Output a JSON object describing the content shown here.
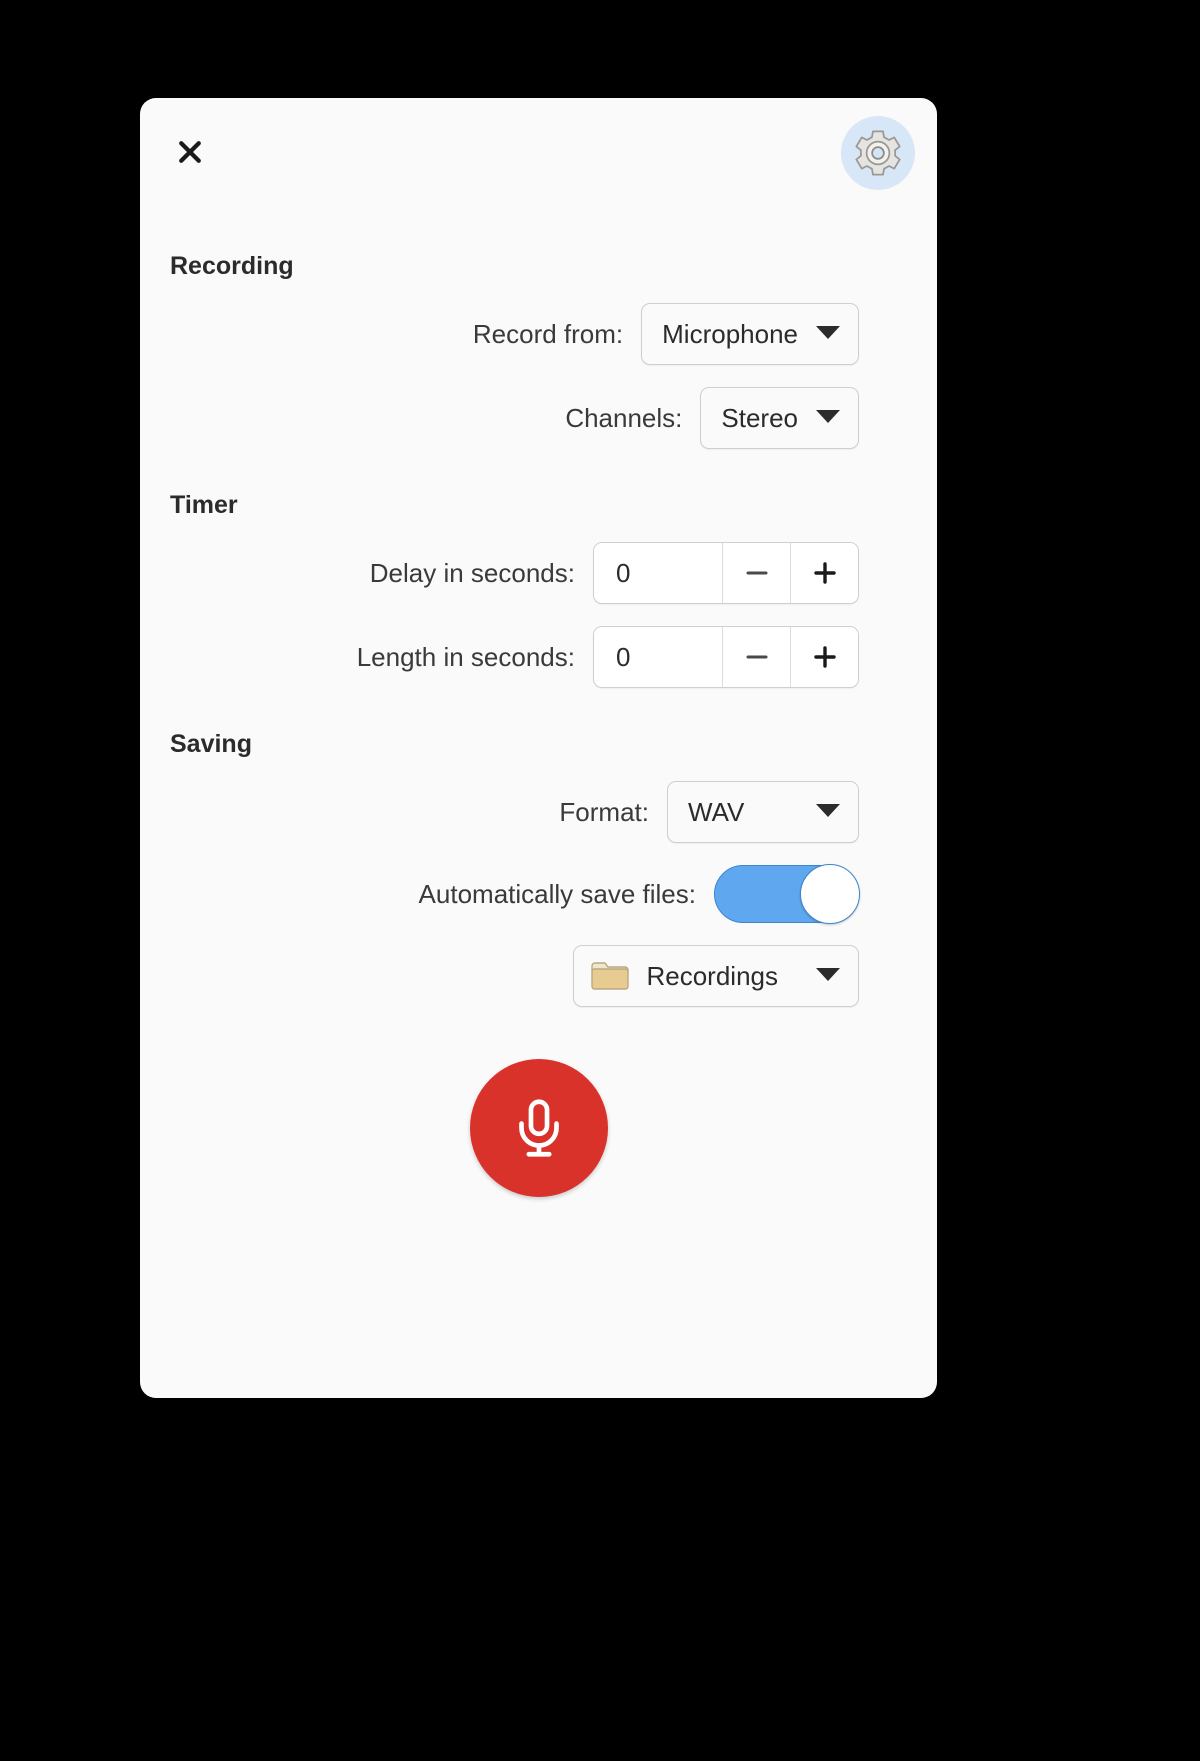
{
  "window": {
    "close_label": "✕",
    "close_icon": "close-icon",
    "settings_icon": "gear-icon"
  },
  "sections": {
    "recording": {
      "title": "Recording",
      "record_from": {
        "label": "Record from:",
        "value": "Microphone",
        "caret_icon": "chevron-down-icon"
      },
      "channels": {
        "label": "Channels:",
        "value": "Stereo",
        "caret_icon": "chevron-down-icon"
      }
    },
    "timer": {
      "title": "Timer",
      "delay": {
        "label": "Delay in seconds:",
        "value": "0",
        "minus_label": "−",
        "plus_label": "+"
      },
      "length": {
        "label": "Length in seconds:",
        "value": "0",
        "minus_label": "−",
        "plus_label": "+"
      }
    },
    "saving": {
      "title": "Saving",
      "format": {
        "label": "Format:",
        "value": "WAV",
        "caret_icon": "chevron-down-icon"
      },
      "auto_save": {
        "label": "Automatically save files:",
        "state": "on"
      },
      "folder": {
        "value": "Recordings",
        "folder_icon": "folder-icon",
        "caret_icon": "chevron-down-icon"
      }
    }
  },
  "record_button": {
    "icon": "microphone-icon",
    "aria_label": "Record"
  },
  "colors": {
    "background": "#000000",
    "card": "#fafafa",
    "accent_blue": "#5fa8f0",
    "settings_bg": "#d7e7f7",
    "record_red": "#d8322b",
    "folder_tan": "#e8cb91",
    "text": "#2b2b2b",
    "border": "#cfcfcf"
  }
}
